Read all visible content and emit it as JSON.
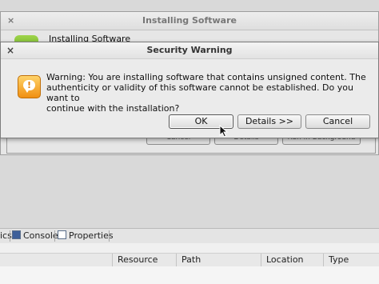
{
  "install_window": {
    "title": "Installing Software",
    "heading": "Installing Software",
    "buttons": [
      "Cancel",
      "Details",
      "Run in Background"
    ]
  },
  "dialog": {
    "title": "Security Warning",
    "close": "×",
    "message": "Warning: You are installing software that contains unsigned content. The\nauthenticity or validity of this software cannot be established. Do you want to\ncontinue with the installation?",
    "buttons": {
      "ok": "OK",
      "details": "Details >>",
      "cancel": "Cancel"
    },
    "icon": "warning-icon"
  },
  "bottom_tabs": [
    "ics",
    "Console",
    "Properties"
  ],
  "table": {
    "columns": [
      "Resource",
      "Path",
      "Location",
      "Type"
    ]
  },
  "colors": {
    "warning_icon": "#f5a623",
    "install_icon": "#7cbb32"
  }
}
